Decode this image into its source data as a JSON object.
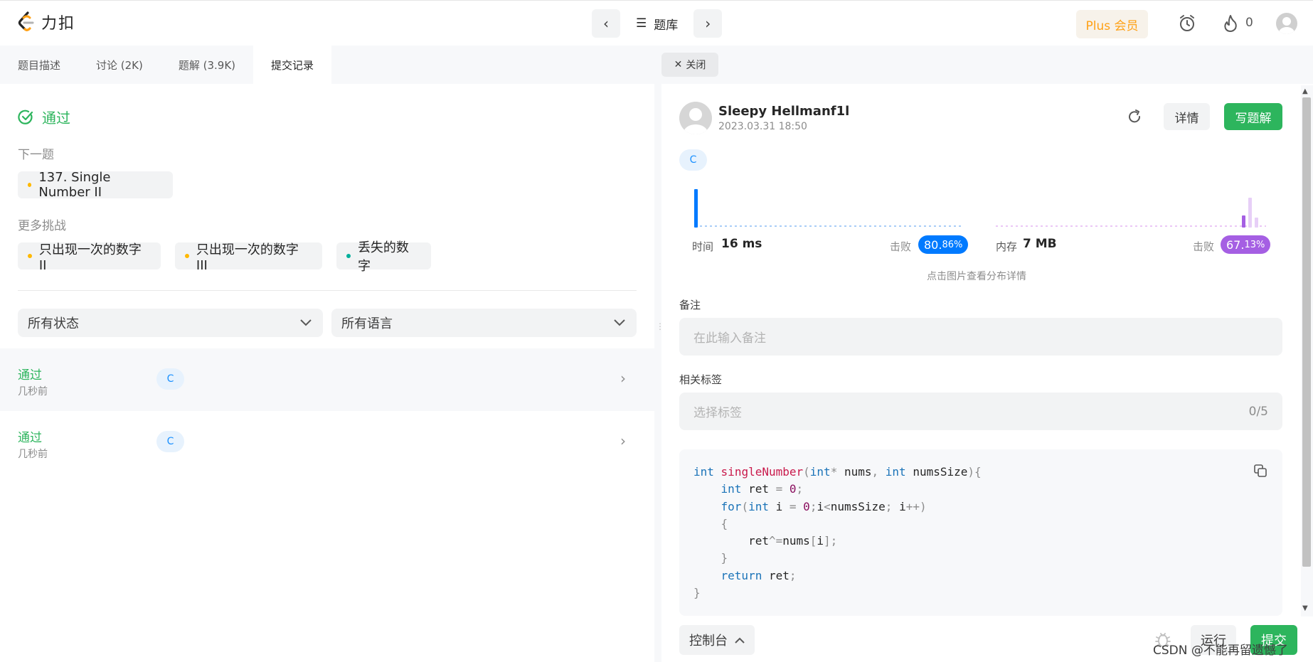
{
  "brand": {
    "name": "力扣"
  },
  "nav": {
    "problem_bank": "题库",
    "plus": "Plus 会员",
    "streak_count": "0"
  },
  "left": {
    "tabs": [
      {
        "label": "题目描述"
      },
      {
        "label": "讨论 (2K)"
      },
      {
        "label": "题解 (3.9K)"
      },
      {
        "label": "提交记录"
      }
    ],
    "status": "通过",
    "next_label": "下一题",
    "next_problem": "137. Single Number II",
    "more_label": "更多挑战",
    "challenges": [
      {
        "label": "只出现一次的数字 II",
        "color": "#ffb800"
      },
      {
        "label": "只出现一次的数字 III",
        "color": "#ffb800"
      },
      {
        "label": "丢失的数字",
        "color": "#00af9b"
      }
    ],
    "filters": {
      "status": "所有状态",
      "language": "所有语言"
    },
    "submissions": [
      {
        "status": "通过",
        "time": "几秒前",
        "lang": "C"
      },
      {
        "status": "通过",
        "time": "几秒前",
        "lang": "C"
      }
    ]
  },
  "right": {
    "close_label": "关闭",
    "user": {
      "name": "Sleepy Hellmanf1l",
      "date": "2023.03.31 18:50"
    },
    "detail_btn": "详情",
    "write_btn": "写题解",
    "lang": "C",
    "runtime": {
      "label": "时间",
      "value": "16 ms",
      "beat_label": "击败",
      "beat_main": "80.",
      "beat_small": "86%",
      "beat_percent": 80.86,
      "color": "#007aff"
    },
    "memory": {
      "label": "内存",
      "value": "7 MB",
      "beat_label": "击败",
      "beat_main": "67.",
      "beat_small": "13%",
      "beat_percent": 67.13,
      "color": "#a55fe3"
    },
    "hint": "点击图片查看分布详情",
    "notes_label": "备注",
    "notes_placeholder": "在此输入备注",
    "tags_label": "相关标签",
    "tags_placeholder": "选择标签",
    "tags_count": "0/5",
    "console": "控制台",
    "run": "运行",
    "submit": "提交",
    "watermark": "CSDN @不能再留遗憾了"
  }
}
